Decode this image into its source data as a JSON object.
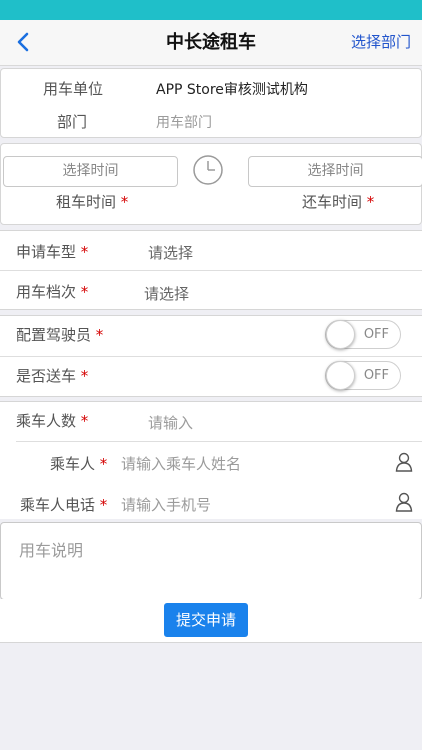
{
  "nav": {
    "title": "中长途租车",
    "back_icon": "chevron-left-icon",
    "right_label": "选择部门"
  },
  "unit": {
    "unit_label": "用车单位",
    "unit_value": "APP Store审核测试机构",
    "dept_label": "部门",
    "dept_placeholder": "用车部门"
  },
  "time": {
    "start_placeholder": "选择时间",
    "end_placeholder": "选择时间",
    "start_label": "租车时间",
    "end_label": "还车时间",
    "required_mark": "*",
    "clock_icon": "clock-icon"
  },
  "vehicle": {
    "type_label": "申请车型",
    "type_value": "请选择",
    "grade_label": "用车档次",
    "grade_value": "请选择",
    "required_mark": "*"
  },
  "options": {
    "driver_label": "配置驾驶员",
    "driver_state": "OFF",
    "delivery_label": "是否送车",
    "delivery_state": "OFF",
    "required_mark": "*"
  },
  "passengers": {
    "count_label": "乘车人数",
    "count_placeholder": "请输入",
    "name_label": "乘车人",
    "name_placeholder": "请输入乘车人姓名",
    "phone_label": "乘车人电话",
    "phone_placeholder": "请输入手机号",
    "required_mark": "*",
    "contact_icon": "person-icon"
  },
  "notes": {
    "placeholder": "用车说明"
  },
  "submit_label": "提交申请",
  "colors": {
    "status_bar": "#1fbfc9",
    "accent": "#1a82ec",
    "link": "#2255cc",
    "required": "#d40000"
  }
}
